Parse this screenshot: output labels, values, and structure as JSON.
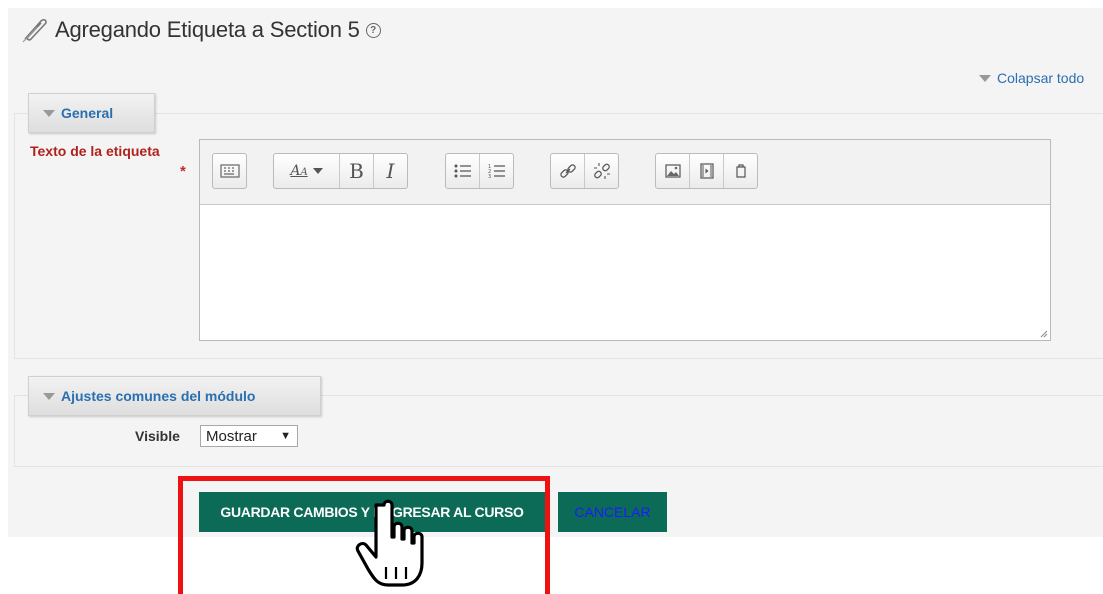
{
  "header": {
    "title": "Agregando Etiqueta a Section 5",
    "help_icon": "question-circle-icon",
    "title_icon": "paperclip-icon"
  },
  "collapse_all_label": "Colapsar todo",
  "sections": {
    "general": {
      "legend": "General"
    },
    "common": {
      "legend": "Ajustes comunes del módulo"
    }
  },
  "fields": {
    "label_text": {
      "label": "Texto de la etiqueta",
      "required_marker": "*",
      "value": ""
    },
    "visible": {
      "label": "Visible",
      "selected": "Mostrar"
    }
  },
  "toolbar": {
    "icons": [
      "toggle-toolbar-icon",
      "font-style-icon",
      "bold-icon",
      "italic-icon",
      "bullet-list-icon",
      "numbered-list-icon",
      "link-icon",
      "unlink-icon",
      "image-icon",
      "media-icon",
      "manage-files-icon"
    ]
  },
  "buttons": {
    "save": "GUARDAR CAMBIOS Y REGRESAR AL CURSO",
    "cancel": "CANCELAR"
  },
  "colors": {
    "accent_link": "#2a6fb0",
    "button_bg": "#0c6b57",
    "required": "#b0221c",
    "highlight": "#ee1111"
  }
}
